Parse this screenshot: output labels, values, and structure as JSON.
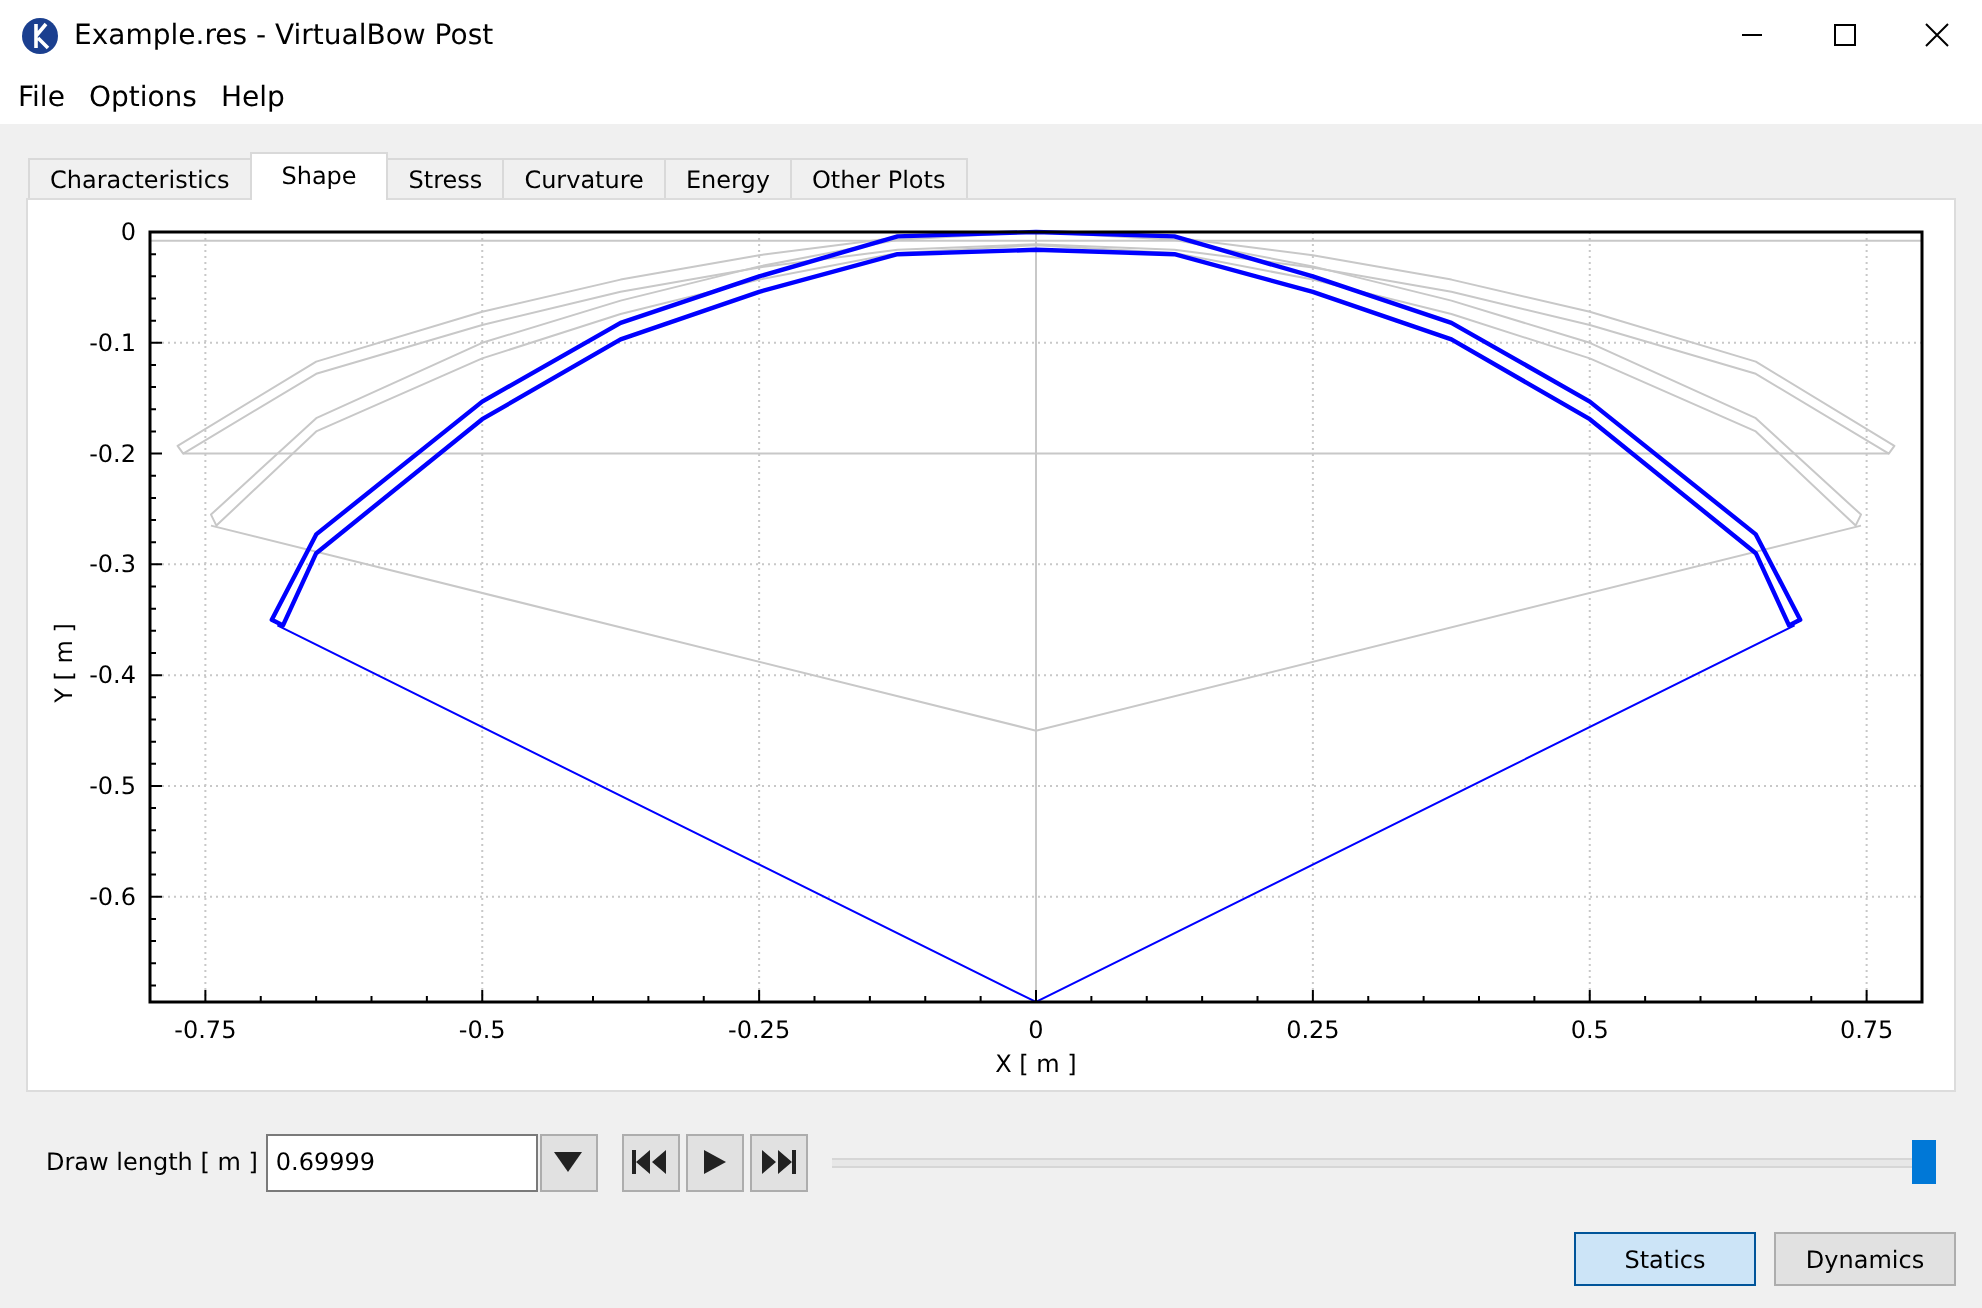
{
  "window": {
    "title": "Example.res - VirtualBow Post"
  },
  "menu": [
    "File",
    "Options",
    "Help"
  ],
  "tabs": [
    {
      "label": "Characteristics",
      "selected": false
    },
    {
      "label": "Shape",
      "selected": true
    },
    {
      "label": "Stress",
      "selected": false
    },
    {
      "label": "Curvature",
      "selected": false
    },
    {
      "label": "Energy",
      "selected": false
    },
    {
      "label": "Other Plots",
      "selected": false
    }
  ],
  "plot": {
    "chart_data": {
      "type": "line",
      "xlabel": "X [ m ]",
      "ylabel": "Y [ m ]",
      "xlim": [
        -0.8,
        0.8
      ],
      "ylim": [
        -0.695,
        0
      ],
      "xticks": [
        -0.75,
        -0.5,
        -0.25,
        0,
        0.25,
        0.5,
        0.75
      ],
      "yticks": [
        0,
        -0.1,
        -0.2,
        -0.3,
        -0.4,
        -0.5,
        -0.6
      ],
      "series": [
        {
          "color": "#c8c8c8",
          "x": [
            -0.8,
            0.8
          ],
          "values": [
            -0.008,
            -0.008
          ]
        },
        {
          "color": "#c8c8c8",
          "x": [
            -0.77,
            0.77
          ],
          "values": [
            -0.2,
            -0.2
          ]
        },
        {
          "color": "#c8c8c8",
          "x": [
            -0.745,
            0,
            0.745
          ],
          "values": [
            -0.265,
            -0.45,
            -0.265
          ]
        },
        {
          "color": "#0000ff",
          "x": [
            -0.685,
            0,
            0.685
          ],
          "values": [
            -0.355,
            -0.695,
            -0.355
          ]
        }
      ]
    }
  },
  "draw_controls": {
    "label": "Draw length [ m ]",
    "value": "0.69999",
    "slider": {
      "level": 1
    }
  },
  "mode_buttons": [
    {
      "label": "Statics",
      "selected": true
    },
    {
      "label": "Dynamics",
      "selected": false
    }
  ]
}
